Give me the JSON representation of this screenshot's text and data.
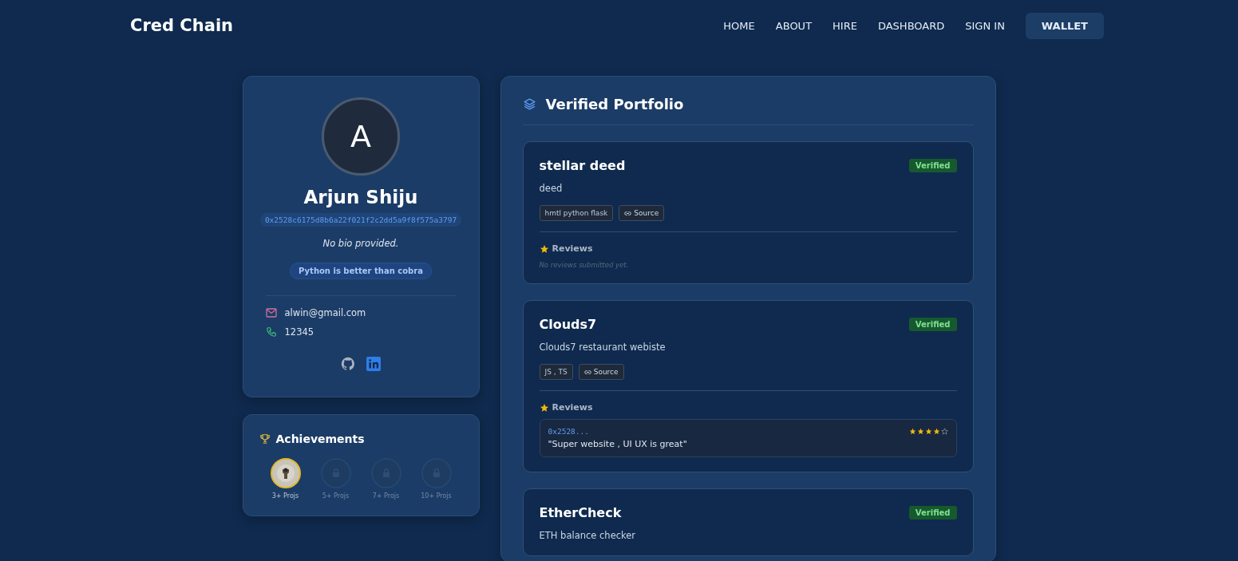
{
  "brand": "Cred Chain",
  "nav": [
    {
      "label": "HOME",
      "kind": "link"
    },
    {
      "label": "ABOUT",
      "kind": "link"
    },
    {
      "label": "HIRE",
      "kind": "link"
    },
    {
      "label": "DASHBOARD",
      "kind": "link"
    },
    {
      "label": "SIGN IN",
      "kind": "link"
    },
    {
      "label": "WALLET",
      "kind": "button"
    }
  ],
  "profile": {
    "initial": "A",
    "name": "Arjun Shiju",
    "address": "0x2528c6175d8b6a22f021f2c2dd5a9f8f575a3797",
    "bio": "No bio provided.",
    "tagline": "Python is better than cobra",
    "email": "alwin@gmail.com",
    "phone": "12345"
  },
  "achievements": {
    "title": "Achievements",
    "items": [
      {
        "label": "3+ Projs",
        "unlocked": true
      },
      {
        "label": "5+ Projs",
        "unlocked": false
      },
      {
        "label": "7+ Projs",
        "unlocked": false
      },
      {
        "label": "10+ Projs",
        "unlocked": false
      }
    ]
  },
  "portfolio": {
    "title": "Verified Portfolio",
    "projects": [
      {
        "title": "stellar deed",
        "status": "Verified",
        "description": "deed",
        "tech": "hmtl python flask",
        "source": "Source",
        "reviews_title": "Reviews",
        "empty_text": "No reviews submitted yet."
      },
      {
        "title": "Clouds7",
        "status": "Verified",
        "description": "Clouds7 restaurant webiste",
        "tech": "JS , TS",
        "source": "Source",
        "reviews_title": "Reviews",
        "reviews": [
          {
            "author": "0x2528...",
            "text": "\"Super website , UI UX is great\"",
            "stars": 4
          }
        ]
      },
      {
        "title": "EtherCheck",
        "status": "Verified",
        "description": "ETH balance checker"
      }
    ]
  }
}
